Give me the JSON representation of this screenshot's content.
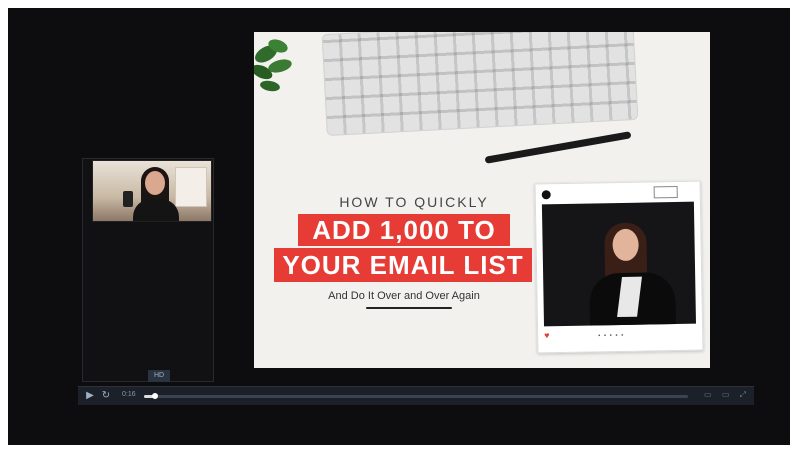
{
  "slide": {
    "title_line1": "HOW TO QUICKLY",
    "title_line2": "ADD 1,000 TO",
    "title_line3": "YOUR EMAIL LIST",
    "subtitle": "And Do It Over and Over Again"
  },
  "instagram_card": {
    "follow_label": "",
    "heart_icon": "heart-icon",
    "dots": "• • • • •"
  },
  "webcam": {
    "badge": "HD"
  },
  "player": {
    "time": "0:16",
    "progress": 0.02,
    "play_icon": "play-icon",
    "skip_icon": "skip-icon",
    "right_icons": "▭ ▭ ⤢"
  },
  "colors": {
    "accent_red": "#e73b36",
    "screen_bg": "#0d0d0f",
    "controls_bg": "#1b2029"
  }
}
